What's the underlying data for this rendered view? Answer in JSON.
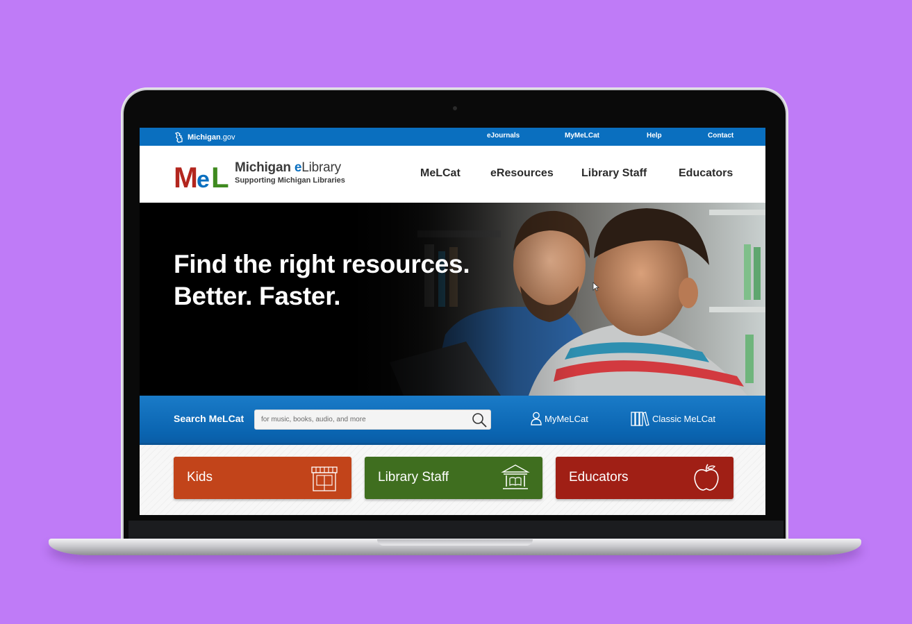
{
  "colors": {
    "background": "#bf7bf7",
    "brand_blue": "#0a6fbf",
    "kids": "#c2441a",
    "library_staff": "#3f6e1f",
    "educators": "#a01f15"
  },
  "utility_bar": {
    "michigan_gov": {
      "label_main": "Michigan",
      "label_suffix": ".gov"
    },
    "links": [
      "eJournals",
      "MyMeLCat",
      "Help",
      "Contact"
    ]
  },
  "header": {
    "logo": {
      "mark": {
        "m": "M",
        "e": "e",
        "l": "L"
      },
      "title_main": "Michigan ",
      "title_e": "e",
      "title_rest": "Library",
      "tagline": "Supporting Michigan Libraries"
    },
    "nav": [
      "MeLCat",
      "eResources",
      "Library Staff",
      "Educators"
    ]
  },
  "hero": {
    "headline_line1": "Find the right resources.",
    "headline_line2": "Better. Faster."
  },
  "search": {
    "label": "Search MeLCat",
    "placeholder": "for music, books, audio, and more",
    "button_icon": "search-icon",
    "links": [
      {
        "label": "MyMeLCat",
        "icon": "user-icon"
      },
      {
        "label": "Classic MeLCat",
        "icon": "books-icon"
      }
    ]
  },
  "cards": [
    {
      "label": "Kids",
      "icon": "storefront-icon"
    },
    {
      "label": "Library Staff",
      "icon": "library-building-icon"
    },
    {
      "label": "Educators",
      "icon": "apple-icon"
    }
  ]
}
